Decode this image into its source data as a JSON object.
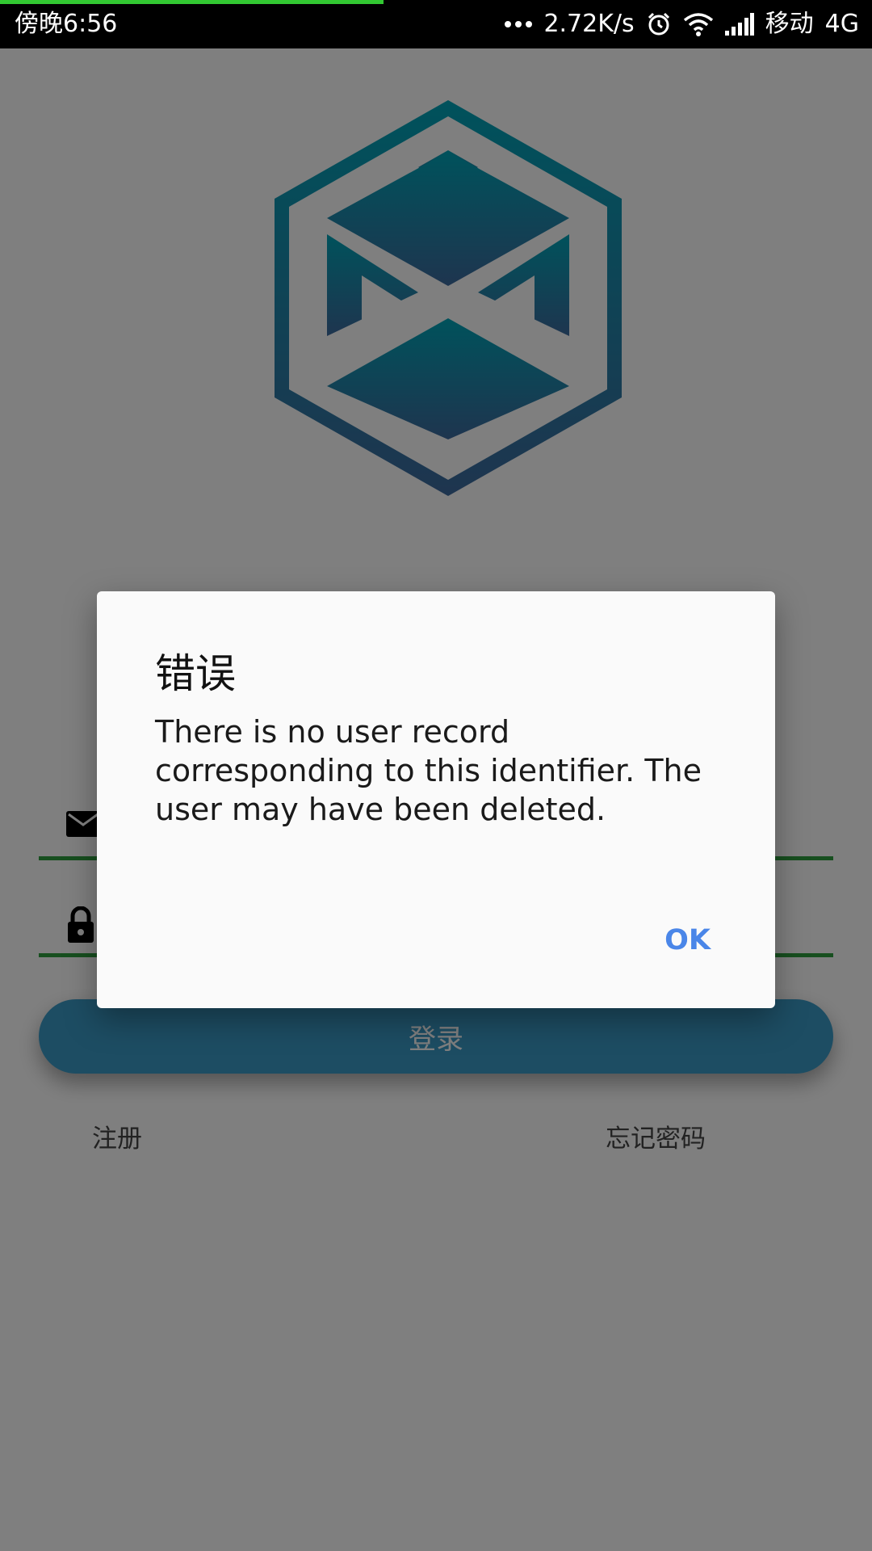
{
  "status_bar": {
    "time": "傍晚6:56",
    "network_speed": "2.72K/s",
    "carrier": "移动",
    "network_type": "4G",
    "progress_fraction": 0.44,
    "icons": [
      "more-dots-icon",
      "alarm-icon",
      "wifi-icon",
      "cell-signal-icon"
    ]
  },
  "app": {
    "title": "",
    "login_label": "登录",
    "register_label": "注册",
    "forgot_password_label": "忘记密码",
    "email_icon": "email-icon",
    "password_icon": "lock-icon",
    "accent_color": "#1b6f87",
    "field_underline_color": "#2e9e3e"
  },
  "dialog": {
    "title": "错误",
    "message": "There is no user record corresponding to this identifier. The user may have been deleted.",
    "ok_label": "OK",
    "ok_color": "#4a86e8"
  }
}
